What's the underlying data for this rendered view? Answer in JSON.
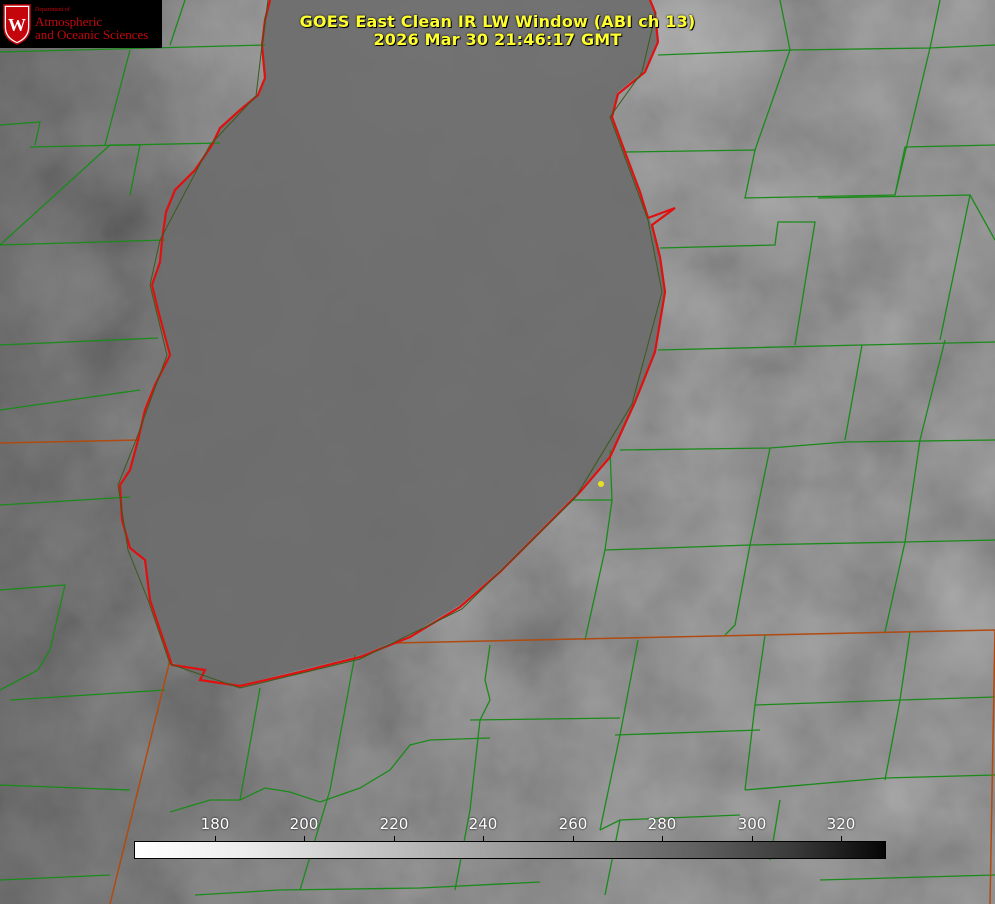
{
  "logo": {
    "dept": "Department of",
    "line1": "Atmospheric",
    "line2": "and Oceanic Sciences",
    "shield_letter": "W"
  },
  "title": {
    "line1": "GOES East Clean IR LW Window (ABI ch 13)",
    "line2": "2026 Mar 30 21:46:17 GMT"
  },
  "colorbar": {
    "ticks": [
      "180",
      "200",
      "220",
      "240",
      "260",
      "280",
      "300",
      "320"
    ],
    "colors": {
      "warm": "#000000",
      "cold": "#ffffff"
    }
  },
  "colors": {
    "county_lines": "#1a8a1a",
    "state_lines": "#b04a10",
    "coastline": "#e01010",
    "marker": "#e8e020",
    "title_text": "#ffff2e"
  }
}
